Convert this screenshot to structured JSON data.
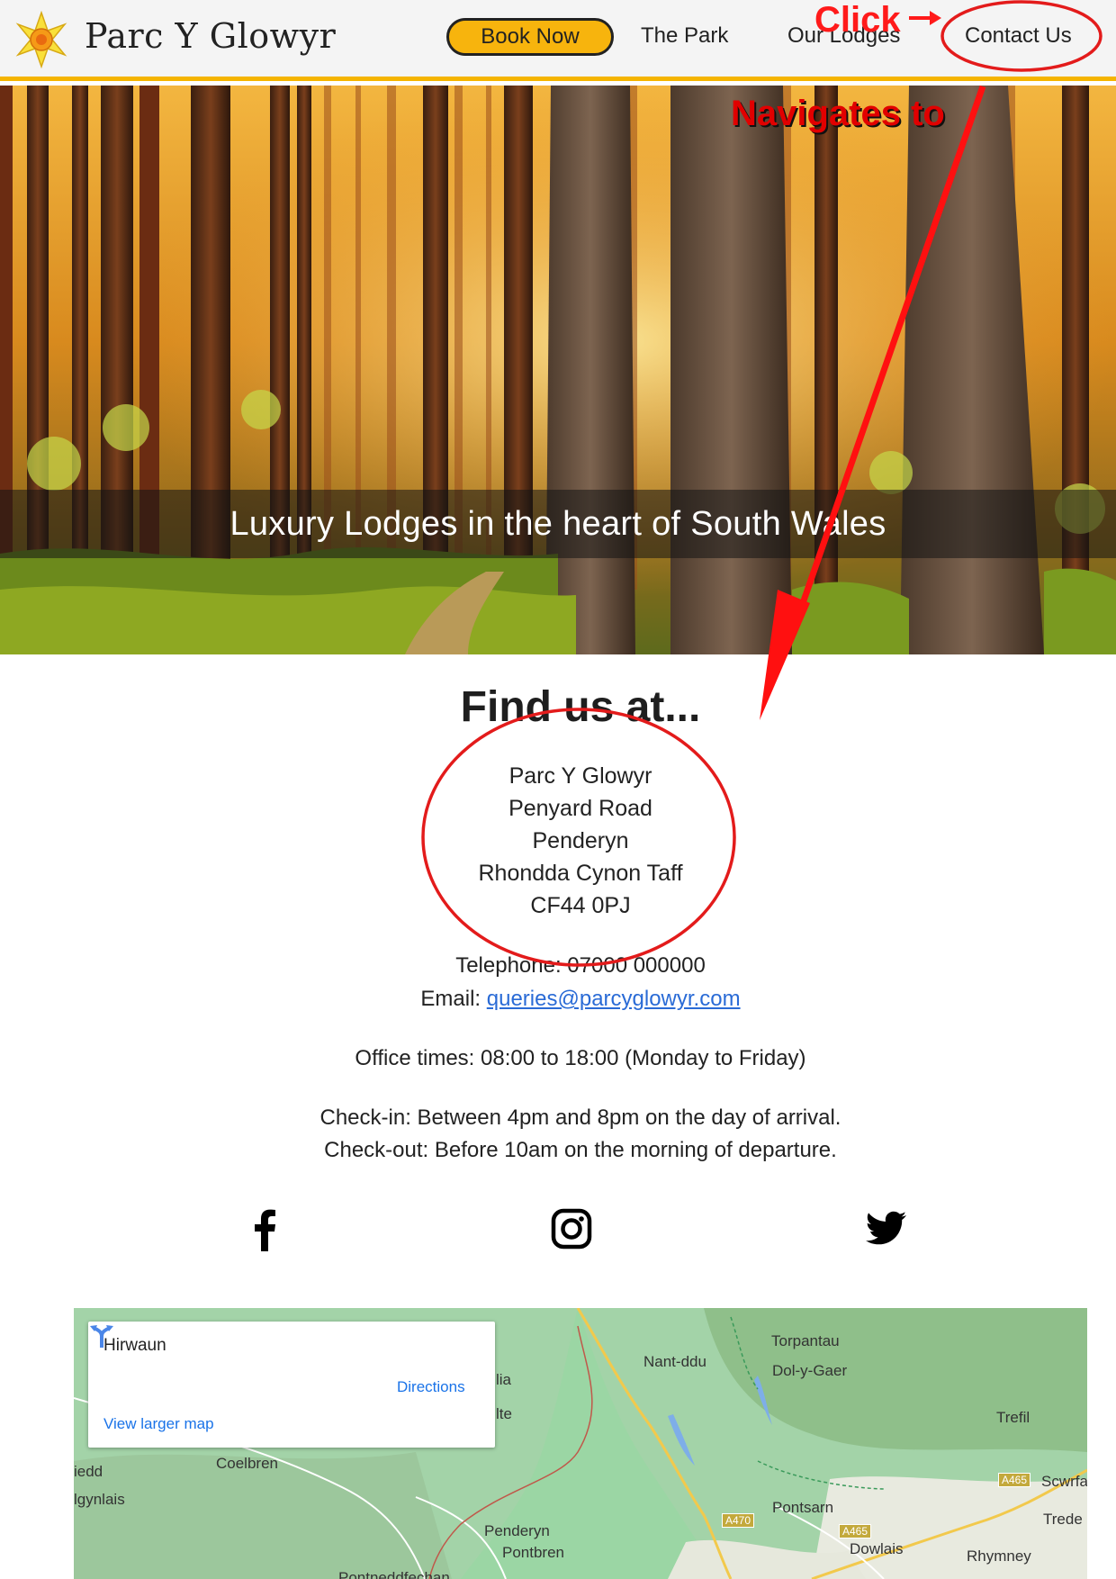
{
  "nav": {
    "brand": "Parc Y Glowyr",
    "book_label": "Book Now",
    "links": [
      "The Park",
      "Our Lodges",
      "Contact Us"
    ]
  },
  "hero": {
    "tagline": "Luxury Lodges in the heart of South Wales"
  },
  "contact": {
    "title": "Find us at...",
    "address": [
      "Parc Y Glowyr",
      "Penyard Road",
      "Penderyn",
      "Rhondda Cynon Taff",
      "CF44 0PJ"
    ],
    "telephone": "Telephone: 07000 000000",
    "email_label": "Email:",
    "email": "queries@parcyglowyr.com",
    "office_times": "Office times: 08:00 to 18:00 (Monday to Friday)",
    "checkin": "Check-in: Between 4pm and 8pm on the day of arrival.",
    "checkout": "Check-out: Before 10am on the morning of departure."
  },
  "social": {
    "icons": [
      "facebook-icon",
      "instagram-icon",
      "twitter-icon"
    ]
  },
  "map": {
    "place": "Hirwaun",
    "directions": "Directions",
    "view_larger": "View larger map",
    "labels": [
      "Nant-ddu",
      "Torpantau",
      "Dol-y-Gaer",
      "Trefil",
      "Coelbren",
      "Pontsarn",
      "Penderyn",
      "Pontbren",
      "Dowlais",
      "Rhymney",
      "Scwrfa",
      "Trede",
      "lia",
      "lte",
      "iedd",
      "lgynlais",
      "Pontneddfechan"
    ],
    "roads": [
      "A470",
      "A465",
      "A465"
    ]
  },
  "annotations": {
    "click": "Click",
    "navigates": "Navigates to"
  },
  "colors": {
    "accent": "#f5b400",
    "annotation": "#ff1a1a",
    "link": "#2a6bd6"
  }
}
